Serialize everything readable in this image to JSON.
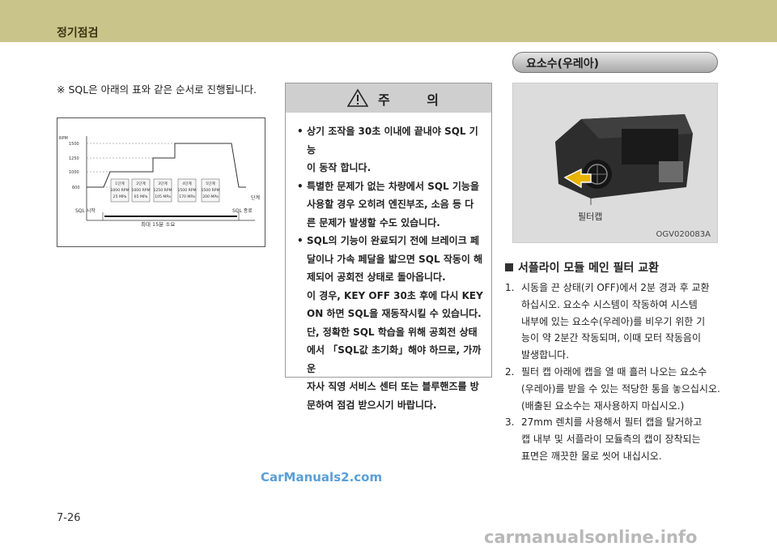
{
  "header": {
    "title": "정기점검"
  },
  "note": "※ SQL은 아래의 표와 같은 순서로 진행됩니다.",
  "diagram": {
    "axis_label": "RPM",
    "y_ticks": [
      "1500",
      "1250",
      "1000",
      "600"
    ],
    "steps": [
      {
        "title": "1단계",
        "rpm": "1000 RPM",
        "pressure": "25 MPa"
      },
      {
        "title": "2단계",
        "rpm": "1000 RPM",
        "pressure": "65 MPa"
      },
      {
        "title": "3단계",
        "rpm": "1250 RPM",
        "pressure": "105 MPa"
      },
      {
        "title": "4단계",
        "rpm": "1500 RPM",
        "pressure": "170 MPa"
      },
      {
        "title": "5단계",
        "rpm": "1500 RPM",
        "pressure": "200 MPa"
      }
    ],
    "stage_label": "단계",
    "start_label": "SQL 시작",
    "end_label": "SQL 종료",
    "duration_label": "최대 15분 소요"
  },
  "caution": {
    "title": "주 의",
    "items": [
      {
        "lines": [
          "상기 조작을 30초 이내에 끝내야 SQL 기능",
          "이 동작 합니다."
        ]
      },
      {
        "lines": [
          "특별한 문제가 없는 차량에서 SQL 기능을",
          "사용할 경우 오히려 엔진부조, 소음 등 다",
          "른 문제가 발생할 수도 있습니다."
        ]
      },
      {
        "lines": [
          "SQL의 기능이 완료되기 전에 브레이크 페",
          "달이나 가속 페달을 밟으면 SQL 작동이 해",
          "제되어 공회전 상태로 돌아옵니다.",
          "이 경우, KEY OFF 30초 후에 다시 KEY",
          "ON 하면 SQL을 재동작시킬 수 있습니다.",
          "단, 정확한 SQL 학습을 위해 공회전 상태",
          "에서 「SQL값 초기화」해야 하므로, 가까운",
          "자사 직영 서비스 센터 또는 블루핸즈를 방",
          "문하여 점검 받으시기 바랍니다."
        ]
      }
    ]
  },
  "section": {
    "title": "요소수(우레아)",
    "photo_label": "필터캡",
    "photo_code": "OGV020083A",
    "subheading": "서플라이 모듈 메인 필터 교환",
    "steps": [
      {
        "num": "1.",
        "lines": [
          "시동을 끈 상태(키 OFF)에서 2분 경과 후 교환",
          "하십시오. 요소수 시스템이 작동하여 시스템",
          "내부에 있는 요소수(우레아)를 비우기 위한 기",
          "능이 약 2분간 작동되며, 이때 모터 작동음이",
          "발생합니다."
        ]
      },
      {
        "num": "2.",
        "lines": [
          "필터 캡 아래에 캡을 열 때 흘러 나오는 요소수",
          "(우레아)를 받을 수 있는 적당한 통을 놓으십시오.",
          "(배출된 요소수는 재사용하지 마십시오.)"
        ]
      },
      {
        "num": "3.",
        "lines": [
          "27mm 렌치를 사용해서 필터 캡을 탈거하고",
          "캡 내부 및 서플라이 모듈측의 캡이 장착되는",
          "표면은 깨끗한 물로 씻어 내십시오."
        ]
      }
    ]
  },
  "watermark": "CarManuals2.com",
  "page_number": "7-26",
  "footer_site": "carmanualsonline.info"
}
